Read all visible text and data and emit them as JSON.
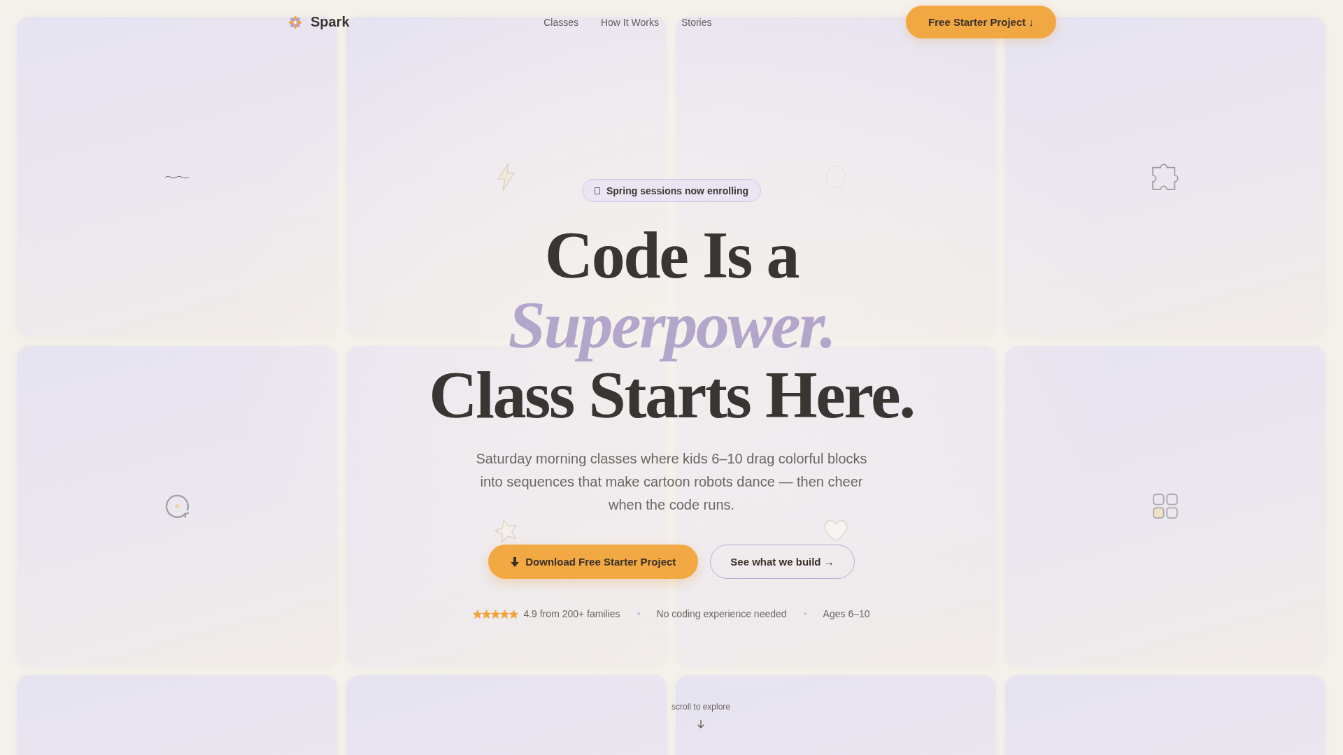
{
  "nav": {
    "brand": "Spark",
    "links": [
      {
        "label": "Classes"
      },
      {
        "label": "How It Works"
      },
      {
        "label": "Stories"
      }
    ],
    "cta": "Free Starter Project ↓"
  },
  "hero": {
    "badge": "Spring sessions now enrolling",
    "title": "Code Is a *Superpower.* Class Starts Here.",
    "subtitle": "Saturday morning classes where kids 6–10 drag colorful blocks into sequences that make cartoon robots dance — then cheer when the code runs.",
    "buttons": [
      {
        "label": "Download Free Starter Project",
        "kind": "primary"
      },
      {
        "label": "See what we build →",
        "kind": "secondary"
      }
    ],
    "proof": {
      "stars": 5,
      "rating": "4.9 from 200+ families",
      "notes": [
        "No coding experience needed",
        "Ages 6–10"
      ]
    }
  },
  "scroll_hint": "scroll to explore"
}
